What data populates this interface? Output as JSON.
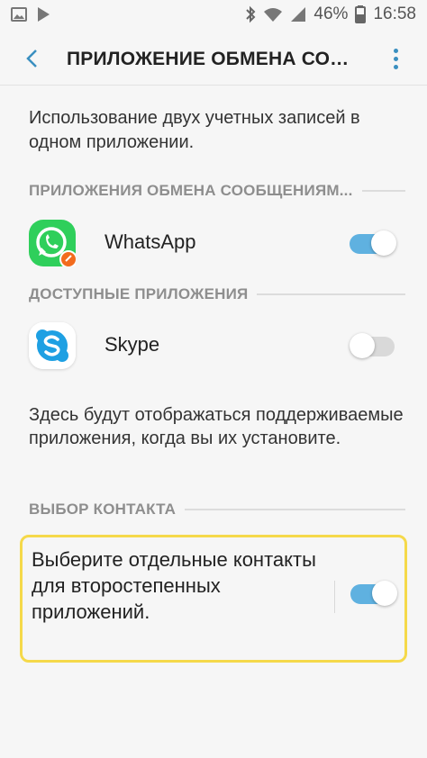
{
  "status_bar": {
    "battery": "46%",
    "time": "16:58"
  },
  "app_bar": {
    "title": "ПРИЛОЖЕНИЕ ОБМЕНА СООБЩЕНИЯМИ"
  },
  "description": "Использование двух учетных записей в одном приложении.",
  "sections": {
    "messaging": {
      "header": "ПРИЛОЖЕНИЯ ОБМЕНА СООБЩЕНИЯМ...",
      "apps": [
        {
          "name": "WhatsApp",
          "enabled": true
        }
      ]
    },
    "available": {
      "header": "ДОСТУПНЫЕ ПРИЛОЖЕНИЯ",
      "apps": [
        {
          "name": "Skype",
          "enabled": false
        }
      ],
      "info": "Здесь будут отображаться поддерживаемые приложения, когда вы их установите."
    },
    "contact": {
      "header": "ВЫБОР КОНТАКТА",
      "option": "Выберите отдельные контакты для второстепенных приложений.",
      "enabled": true
    }
  },
  "colors": {
    "accent": "#5fb1e0",
    "highlight": "#f5d94a",
    "whatsapp": "#2fcf5b",
    "skype": "#1ea0e3"
  }
}
